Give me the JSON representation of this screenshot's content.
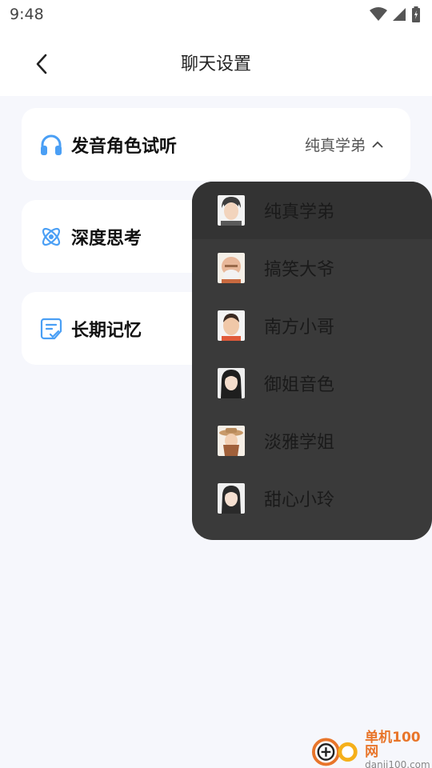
{
  "status_bar": {
    "time": "9:48"
  },
  "header": {
    "title": "聊天设置",
    "back_icon": "chevron-left-icon"
  },
  "settings": [
    {
      "id": "voice",
      "label": "发音角色试听",
      "icon": "headphones-icon",
      "value": "纯真学弟",
      "accent": "#4a9ff5"
    },
    {
      "id": "deep-think",
      "label": "深度思考",
      "icon": "atom-icon",
      "accent": "#4a9ff5"
    },
    {
      "id": "memory",
      "label": "长期记忆",
      "icon": "memo-check-icon",
      "accent": "#4a9ff5"
    }
  ],
  "voice_options": [
    {
      "label": "纯真学弟",
      "avatar": "young-man-avatar",
      "selected": true
    },
    {
      "label": "搞笑大爷",
      "avatar": "old-man-avatar",
      "selected": false
    },
    {
      "label": "南方小哥",
      "avatar": "boy-avatar",
      "selected": false
    },
    {
      "label": "御姐音色",
      "avatar": "woman-dark-hair-avatar",
      "selected": false
    },
    {
      "label": "淡雅学姐",
      "avatar": "cowgirl-avatar",
      "selected": false
    },
    {
      "label": "甜心小玲",
      "avatar": "girl-long-hair-avatar",
      "selected": false
    }
  ],
  "watermark": {
    "cn": "单机100网",
    "en": "danji100.com"
  },
  "colors": {
    "background": "#f6f7fc",
    "card": "#ffffff",
    "dropdown": "#3a3a3a",
    "accent": "#4a9ff5",
    "watermark": "#e8752a"
  }
}
